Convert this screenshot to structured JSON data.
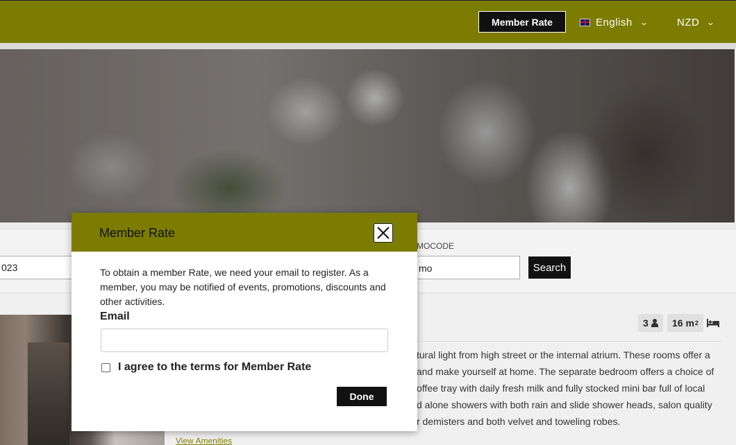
{
  "header": {
    "member_rate_label": "Member Rate",
    "language": {
      "label": "English",
      "icon": "uk-flag-icon"
    },
    "currency": "NZD",
    "brand_color": "#7c7c02"
  },
  "search": {
    "date_value": "023",
    "date_separator": "-",
    "promo_label": "MOCODE",
    "promo_value": "mo",
    "search_label": "Search"
  },
  "room": {
    "guests": "3",
    "size": "16 m",
    "size_sup": "2",
    "description_lines": [
      "tural light from high street or the internal atrium. These rooms offer a",
      "and make yourself at home. The separate bedroom offers a choice of",
      "offee tray with daily fresh milk and fully stocked mini bar full of local",
      "d alone showers with both rain and slide shower heads, salon quality",
      "r demisters and both velvet and toweling robes."
    ],
    "amenities_link": "View Amenities"
  },
  "modal": {
    "title": "Member Rate",
    "text": "To obtain a member Rate, we need your email to register. As a member, you may be notified of events, promotions, discounts and other activities.",
    "email_label": "Email",
    "email_value": "",
    "agree_label": "I agree to the terms for Member Rate",
    "done_label": "Done"
  }
}
